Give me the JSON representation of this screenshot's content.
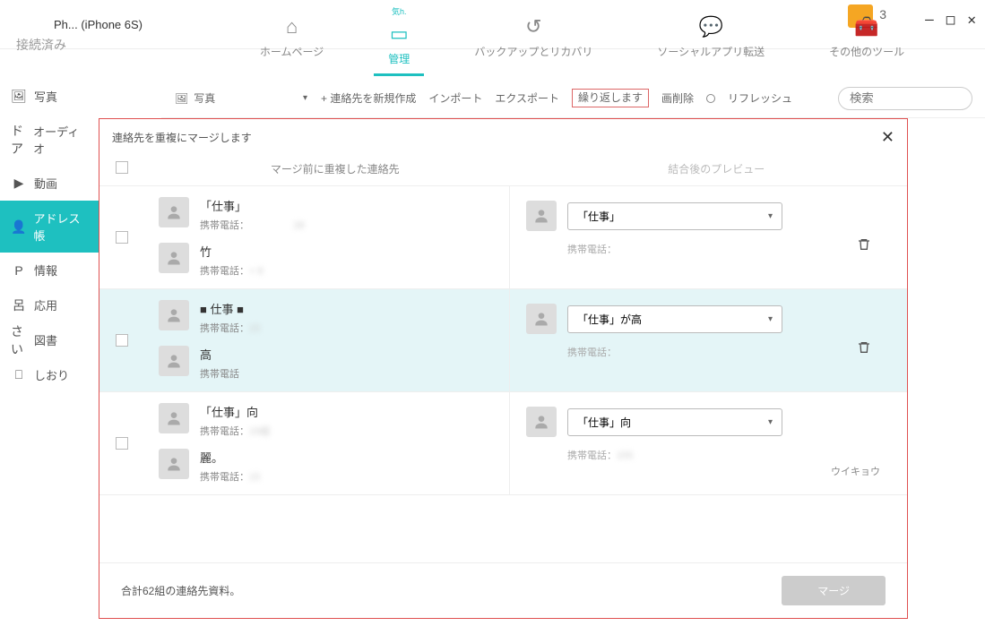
{
  "window": {
    "device": "Ph... (iPhone 6S)",
    "status": "接続済み",
    "badge_num": "3"
  },
  "topnav": {
    "home": "ホームページ",
    "manage": "管理",
    "manage_sub": "気h.",
    "backup": "バックアップとリカバリ",
    "social": "ソーシャルアプリ転送",
    "other": "その他のツール"
  },
  "sidebar": {
    "photo": "写真",
    "audio": "オーディオ",
    "video": "動画",
    "contacts": "アドレス帳",
    "info": "情報",
    "app": "応用",
    "book": "図書",
    "bookmark": "しおり",
    "p_prefix": "P",
    "r_prefix": "呂",
    "s_prefix": "さい",
    "d_prefix": "ドア"
  },
  "toolbar": {
    "picker_label": "写真",
    "new": "+ 連絡先を新規作成",
    "import": "インポート",
    "export": "エクスポート",
    "repeat": "繰り返します",
    "delete": "画削除",
    "refresh": "リフレッシュ",
    "search_placeholder": "検索"
  },
  "modal": {
    "title": "連絡先を重複にマージします",
    "col1": "マージ前に重複した連絡先",
    "col2": "結合後のプレビュー",
    "footer_text": "合計62組の連絡先資料。",
    "merge_btn": "マージ",
    "groups": [
      {
        "highlighted": false,
        "contacts": [
          {
            "name": "「仕事」",
            "phone_label": "携帯電話：",
            "phone_blur": "　　　　　28"
          },
          {
            "name": "竹",
            "phone_label": "携帯電話：",
            "phone_blur": "+ 8　　　　　"
          }
        ],
        "merged": {
          "select": "「仕事」",
          "phone_label": "携帯電話：",
          "phone_blur": "　　　　　"
        }
      },
      {
        "highlighted": true,
        "contacts": [
          {
            "name": "■ 仕事 ■",
            "phone_label": "携帯電話：",
            "phone_blur": "15　　　　"
          },
          {
            "name": "高",
            "phone_label": "携帯電話",
            "phone_blur": "　　　　　"
          }
        ],
        "merged": {
          "select": "「仕事」が高",
          "phone_label": "携帯電話：",
          "phone_blur": "　　　　　"
        }
      },
      {
        "highlighted": false,
        "contacts": [
          {
            "name": "「仕事」向",
            "phone_label": "携帯電話：",
            "phone_blur": "15組　　　"
          },
          {
            "name": "麗。",
            "phone_label": "携帯電話：",
            "phone_blur": "15　　　　"
          }
        ],
        "merged": {
          "select": "「仕事」向",
          "phone_label": "携帯電話：",
          "phone_blur": "155　　　",
          "tag": "ウイキョウ"
        }
      }
    ]
  }
}
